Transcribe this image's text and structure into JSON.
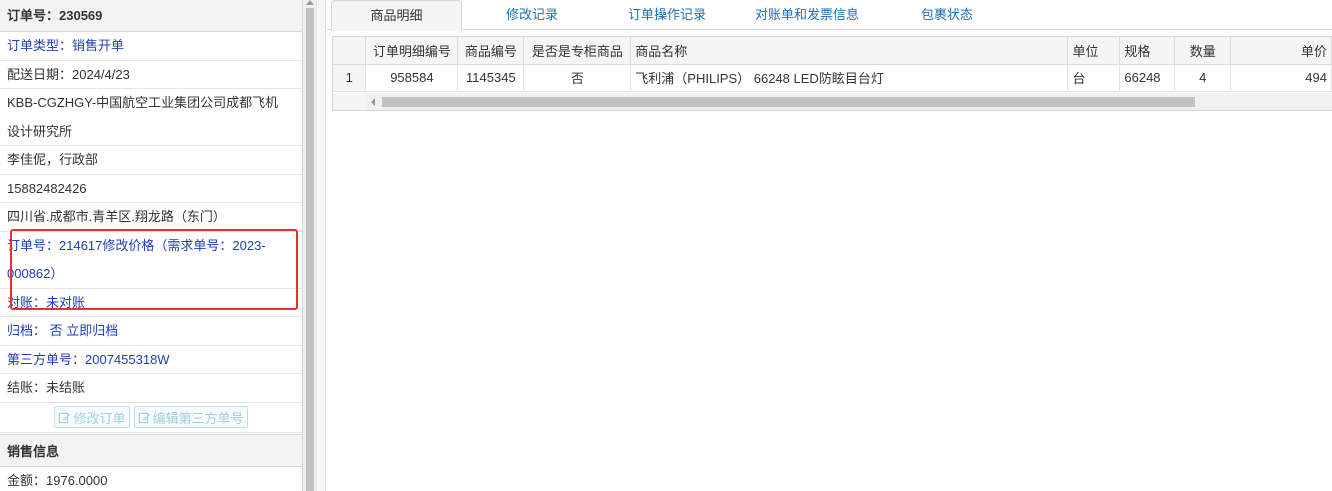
{
  "left": {
    "header": "订单号：230569",
    "rows": [
      "订单类型：销售开单",
      "配送日期：2024/4/23",
      "KBB-CGZHGY-中国航空工业集团公司成都飞机设计研究所",
      "李佳伲，行政部",
      "15882482426",
      "四川省.成都市.青羊区.翔龙路（东门）",
      "订单号：214617修改价格（需求单号：2023-000862）",
      "对账：未对账",
      "归档： 否 立即归档",
      "第三方单号：2007455318W",
      "结账：未结账"
    ],
    "buttons": {
      "edit_order": "修改订单",
      "edit_third_party": "编辑第三方单号"
    },
    "sales_section": "销售信息",
    "amount": "金额：1976.0000"
  },
  "tabs": [
    "商品明细",
    "修改记录",
    "订单操作记录",
    "对账单和发票信息",
    "包裹状态"
  ],
  "grid": {
    "columns": [
      "订单明细编号",
      "商品编号",
      "是否是专柜商品",
      "商品名称",
      "单位",
      "规格",
      "数量",
      "单价"
    ],
    "rows": [
      {
        "rownum": "1",
        "detail_id": "958584",
        "product_id": "1145345",
        "is_counter": "否",
        "name": "飞利浦（PHILIPS） 66248 LED防眩目台灯",
        "unit": "台",
        "spec": "66248",
        "qty": "4",
        "price": "494"
      }
    ]
  },
  "colors": {
    "link": "#1f3fb5",
    "highlight": "#e83030",
    "tab_link": "#1f6fb5"
  }
}
